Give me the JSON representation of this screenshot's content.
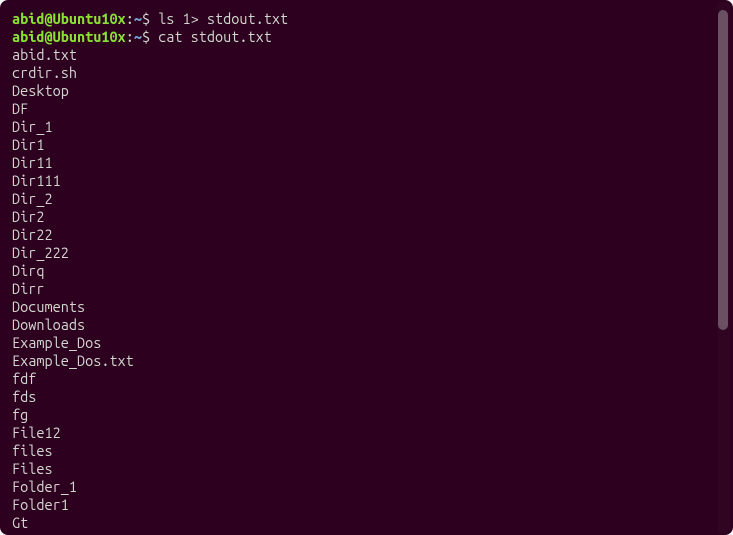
{
  "prompt": {
    "user_host": "abid@Ubuntu10x",
    "colon": ":",
    "path": "~",
    "dollar": "$ "
  },
  "commands": [
    "ls 1> stdout.txt",
    "cat stdout.txt"
  ],
  "output_lines": [
    "abid.txt",
    "crdir.sh",
    "Desktop",
    "DF",
    "Dir_1",
    "Dir1",
    "Dir11",
    "Dir111",
    "Dir_2",
    "Dir2",
    "Dir22",
    "Dir_222",
    "Dirq",
    "Dirr",
    "Documents",
    "Downloads",
    "Example_Dos",
    "Example_Dos.txt",
    "fdf",
    "fds",
    "fg",
    "File12",
    "files",
    "Files",
    "Folder_1",
    "Folder1",
    "Gt"
  ]
}
